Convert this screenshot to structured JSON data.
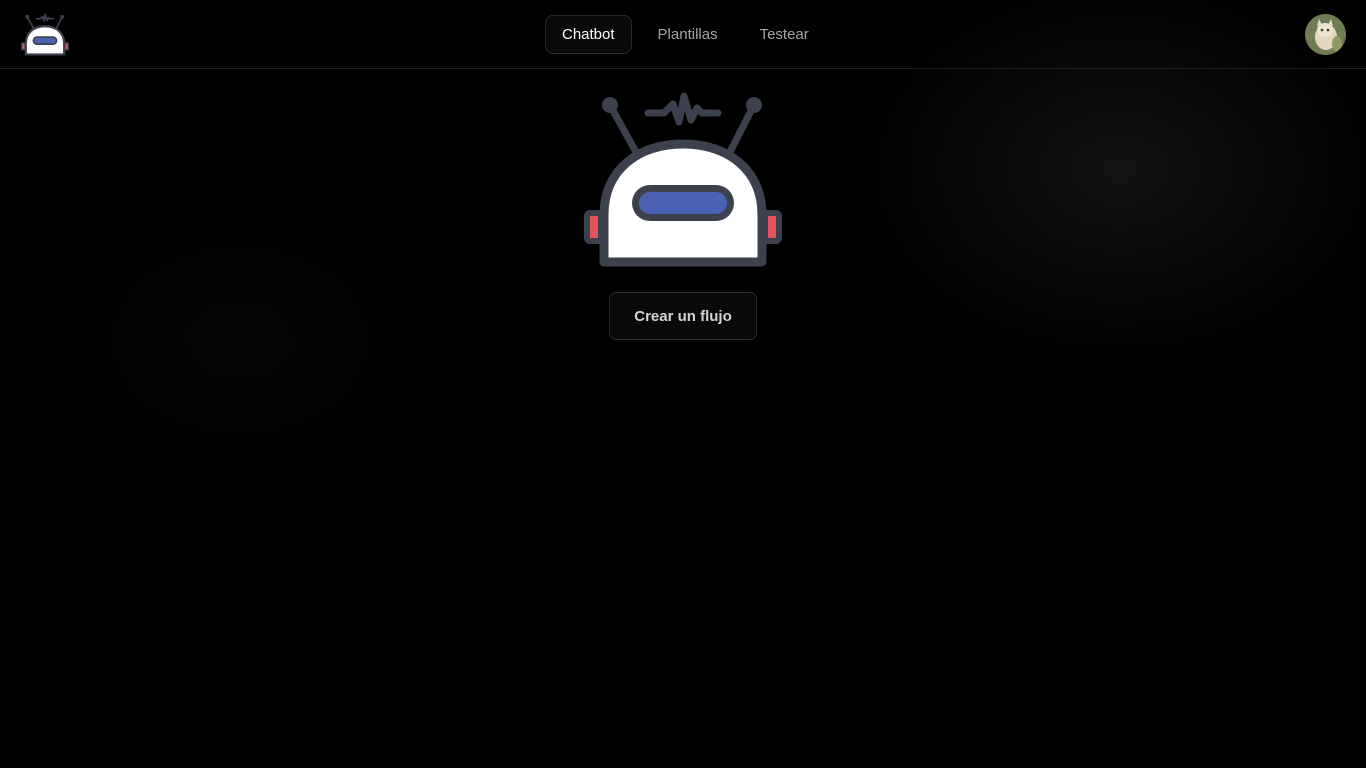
{
  "header": {
    "logo_icon": "robot-logo-icon",
    "nav": {
      "tabs": [
        {
          "label": "Chatbot",
          "active": true
        },
        {
          "label": "Plantillas",
          "active": false
        },
        {
          "label": "Testear",
          "active": false
        }
      ]
    },
    "avatar_icon": "user-avatar"
  },
  "main": {
    "hero_icon": "robot-icon",
    "create_button_label": "Crear un flujo"
  },
  "colors": {
    "background": "#000000",
    "robot_outline": "#3d414d",
    "robot_visor": "#4b62b4",
    "robot_ears": "#e5535f",
    "robot_face": "#ffffff"
  }
}
